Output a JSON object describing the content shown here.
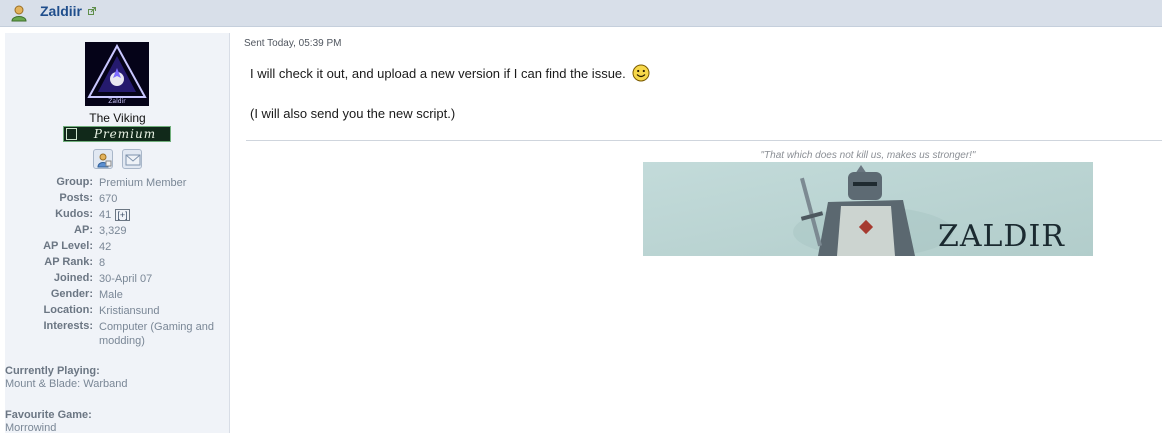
{
  "header": {
    "username": "Zaldiir"
  },
  "profile": {
    "avatar_caption": "Zaldir",
    "title": "The Viking",
    "rank_badge": "Premium",
    "fields": [
      {
        "label": "Group:",
        "value": "Premium Member"
      },
      {
        "label": "Posts:",
        "value": "670"
      },
      {
        "label": "Kudos:",
        "value": "41",
        "extra": "[+]"
      },
      {
        "label": "AP:",
        "value": "3,329"
      },
      {
        "label": "AP Level:",
        "value": "42"
      },
      {
        "label": "AP Rank:",
        "value": "8"
      },
      {
        "label": "Joined:",
        "value": "30-April 07"
      },
      {
        "label": "Gender:",
        "value": "Male"
      },
      {
        "label": "Location:",
        "value": "Kristiansund"
      },
      {
        "label": "Interests:",
        "value": "Computer (Gaming and modding)"
      }
    ],
    "currently_playing": {
      "label": "Currently Playing:",
      "value": "Mount & Blade: Warband"
    },
    "favourite_game": {
      "label": "Favourite Game:",
      "value": "Morrowind"
    }
  },
  "post": {
    "meta": "Sent Today, 05:39 PM",
    "lines": [
      "I will check it out, and upload a new version if I can find the issue.",
      "(I will also send you the new script.)"
    ],
    "signature_quote": "\"That which does not kill us, makes us stronger!\"",
    "signature_banner_text": "ZALDIR"
  },
  "colors": {
    "header_bg": "#d8dfe9",
    "sidebar_bg": "#f0f3f8",
    "username": "#1f4e8c",
    "banner_bg": "#bcd4d2"
  },
  "icons": [
    "user-icon",
    "external-link-icon",
    "profile-icon",
    "message-icon",
    "smiley-icon"
  ]
}
